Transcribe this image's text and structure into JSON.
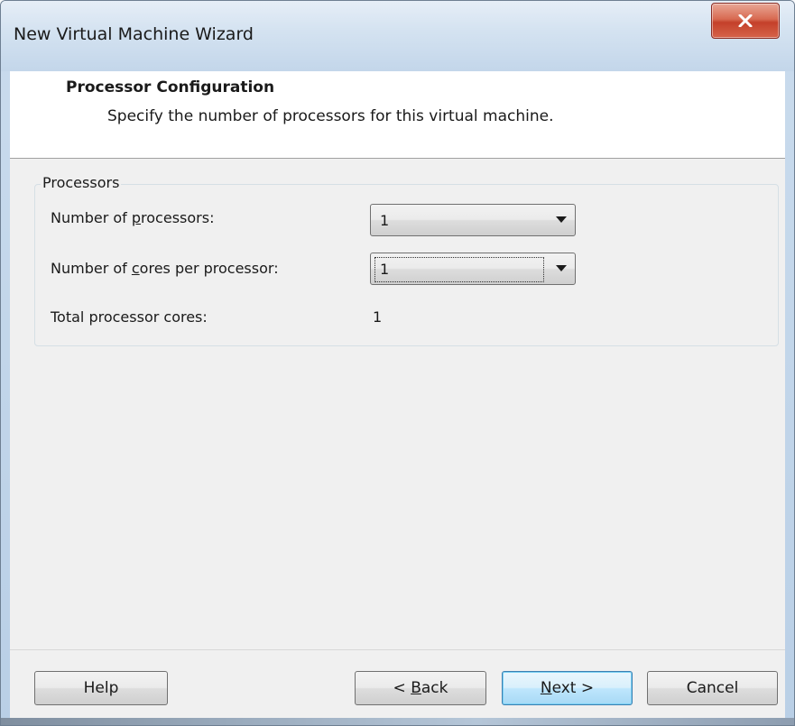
{
  "window": {
    "title": "New Virtual Machine Wizard"
  },
  "header": {
    "title": "Processor Configuration",
    "description": "Specify the number of processors for this virtual machine."
  },
  "processors_group": {
    "caption": "Processors",
    "num_processors": {
      "label_prefix": "Number of ",
      "label_access_key": "p",
      "label_suffix": "rocessors:",
      "value": "1"
    },
    "cores_per_processor": {
      "label_prefix": "Number of ",
      "label_access_key": "c",
      "label_suffix": "ores per processor:",
      "value": "1"
    },
    "total_cores": {
      "label": "Total processor cores:",
      "value": "1"
    }
  },
  "buttons": {
    "help": "Help",
    "back_prefix": "< ",
    "back_access_key": "B",
    "back_suffix": "ack",
    "next_access_key": "N",
    "next_suffix": "ext >",
    "cancel": "Cancel"
  },
  "colors": {
    "close_button": "#c4402a",
    "default_button_border": "#3c7fb1",
    "client_background": "#f0f0f0"
  }
}
